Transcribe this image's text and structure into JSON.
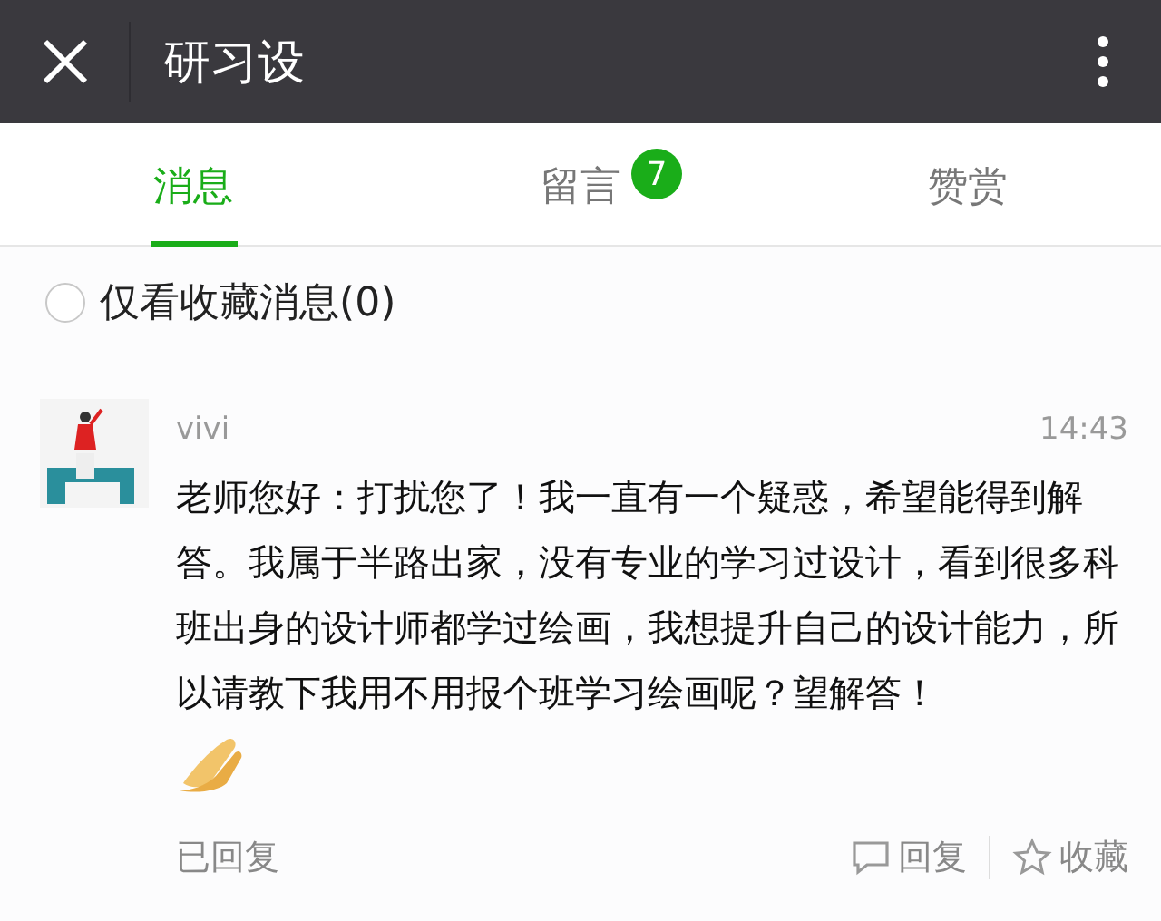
{
  "window": {
    "title": "研习设"
  },
  "tabs": [
    {
      "label": "消息",
      "selected": true
    },
    {
      "label": "留言",
      "selected": false,
      "badge": "7"
    },
    {
      "label": "赞赏",
      "selected": false
    }
  ],
  "filter": {
    "label": "仅看收藏消息(0)",
    "checked": false
  },
  "messages": [
    {
      "name": "vivi",
      "time": "14:43",
      "text": "老师您好：打扰您了！我一直有一个疑惑，希望能得到解答。我属于半路出家，没有专业的学习过设计，看到很多科班出身的设计师都学过绘画，我想提升自己的设计能力，所以请教下我用不用报个班学习绘画呢？望解答！",
      "status": "已回复",
      "reply": "回复",
      "favorite": "收藏"
    }
  ]
}
